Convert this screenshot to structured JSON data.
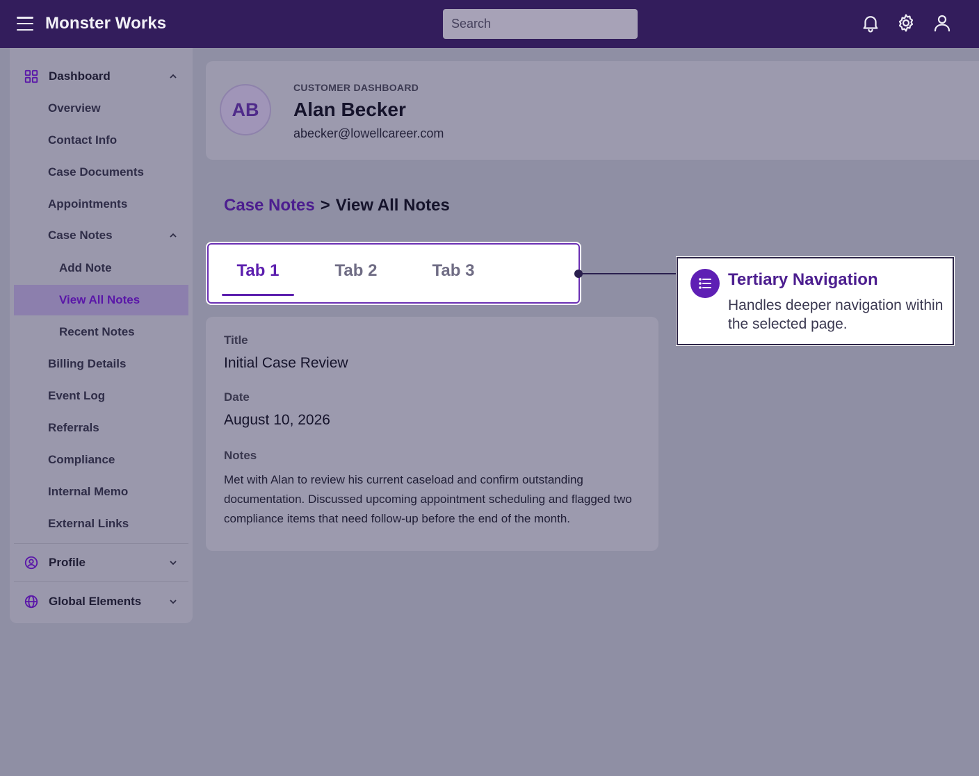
{
  "app": {
    "title": "Monster Works",
    "search_placeholder": "Search",
    "icons": [
      "menu-icon",
      "bell-icon",
      "gear-icon",
      "user-icon"
    ]
  },
  "colors": {
    "topbar": "#331d5c",
    "accent": "#5c1fae",
    "overlay_bg": "#8f8fa4"
  },
  "sidebar": {
    "dashboard": "Dashboard",
    "items": [
      "Overview",
      "Contact Info",
      "Case Documents",
      "Appointments",
      "Case Notes"
    ],
    "case_notes_children": [
      "Add Note",
      "View All Notes",
      "Recent Notes"
    ],
    "items_after": [
      "Billing Details",
      "Event Log",
      "Referrals",
      "Compliance",
      "Internal Memo",
      "External Links"
    ],
    "profile": "Profile",
    "global_elements": "Global Elements",
    "active_item": "View All Notes"
  },
  "customer": {
    "eyebrow": "CUSTOMER DASHBOARD",
    "initials": "AB",
    "name": "Alan Becker",
    "email": "abecker@lowellcareer.com"
  },
  "breadcrumb": {
    "parent": "Case Notes",
    "separator": ">",
    "current": "View All Notes"
  },
  "tabs": [
    {
      "label": "Tab 1",
      "active": true
    },
    {
      "label": "Tab 2",
      "active": false
    },
    {
      "label": "Tab 3",
      "active": false
    }
  ],
  "callout": {
    "title": "Tertiary Navigation",
    "text": "Handles deeper navigation within the selected page."
  },
  "note": {
    "title_label": "Title",
    "title_value": "Initial Case Review",
    "date_label": "Date",
    "date_value": "August 10, 2026",
    "notes_label": "Notes",
    "notes_value": "Met with Alan to review his current caseload and confirm outstanding documentation. Discussed upcoming appointment scheduling and flagged two compliance items that need follow-up before the end of the month."
  }
}
